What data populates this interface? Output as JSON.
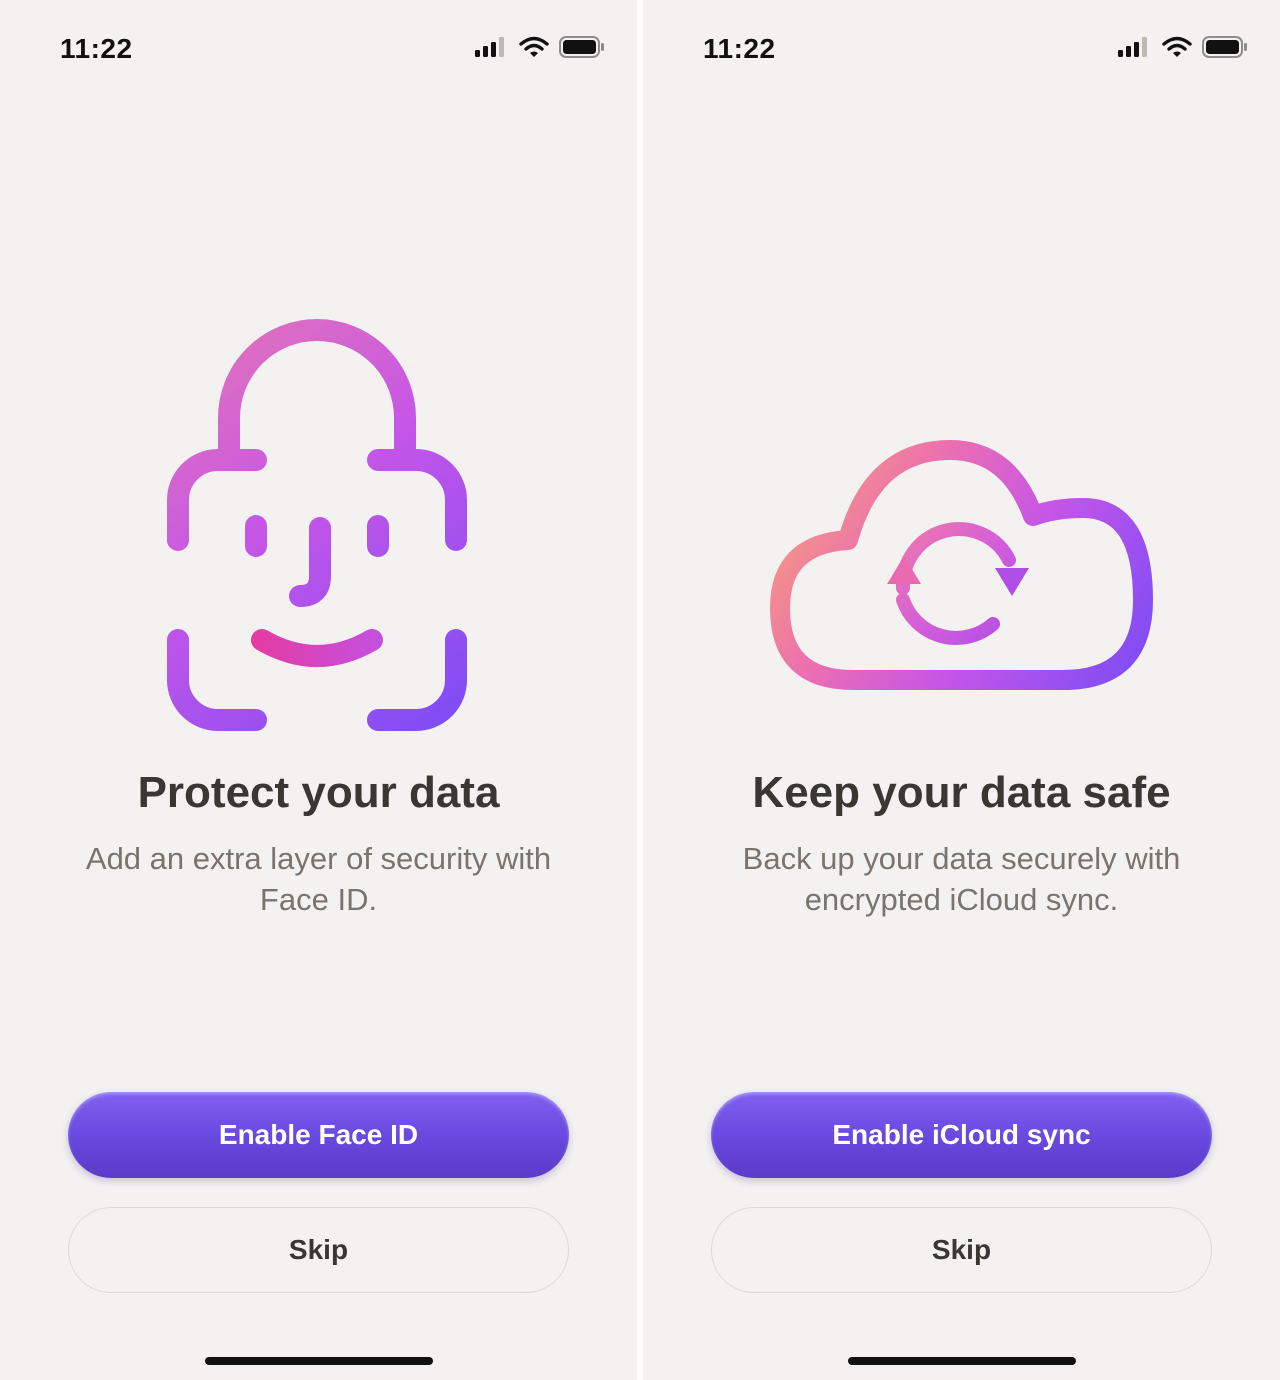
{
  "screens": [
    {
      "status_time": "11:22",
      "illustration_icon": "face-id-lock-icon",
      "title": "Protect your data",
      "subtitle": "Add an extra layer of security with Face ID.",
      "primary_button": "Enable Face ID",
      "secondary_button": "Skip"
    },
    {
      "status_time": "11:22",
      "illustration_icon": "icloud-sync-icon",
      "title": "Keep your data safe",
      "subtitle": "Back up your data securely with encrypted iCloud sync.",
      "primary_button": "Enable iCloud sync",
      "secondary_button": "Skip"
    }
  ],
  "colors": {
    "accent_button": "#6a49e0",
    "gradient_pink": "#e0409a",
    "gradient_magenta": "#c455e8",
    "gradient_purple": "#7b4cf5",
    "gradient_orange": "#f5a07a",
    "background": "#f3f2f1",
    "title_text": "#3a3631",
    "subtitle_text": "#7b736c"
  }
}
